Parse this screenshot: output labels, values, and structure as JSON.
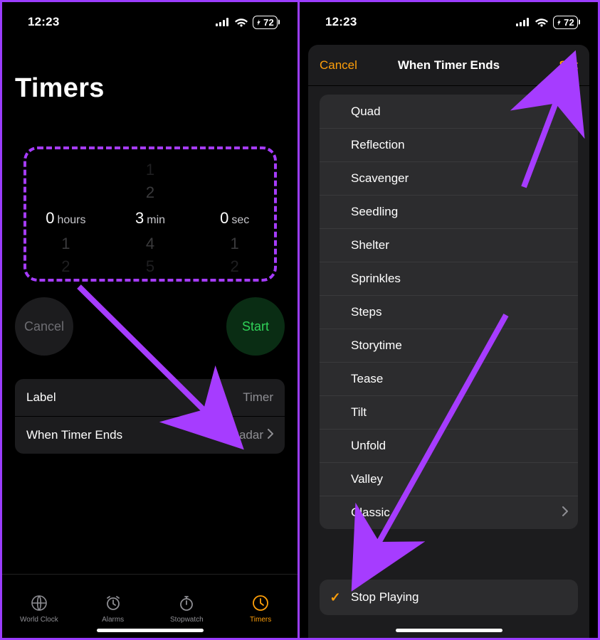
{
  "left": {
    "status": {
      "time": "12:23",
      "battery": "72"
    },
    "title": "Timers",
    "picker": {
      "hours": {
        "cur": "0",
        "m1": "",
        "m2": "",
        "p1": "1",
        "p2": "2",
        "unit": "hours"
      },
      "minutes": {
        "cur": "3",
        "m1": "2",
        "m2": "1",
        "p1": "4",
        "p2": "5",
        "unit": "min"
      },
      "seconds": {
        "cur": "0",
        "m1": "",
        "m2": "",
        "p1": "1",
        "p2": "2",
        "unit": "sec"
      }
    },
    "buttons": {
      "cancel": "Cancel",
      "start": "Start"
    },
    "settings": {
      "label_title": "Label",
      "label_value": "Timer",
      "ends_title": "When Timer Ends",
      "ends_value": "Radar"
    },
    "tabs": {
      "world": "World Clock",
      "alarms": "Alarms",
      "stopwatch": "Stopwatch",
      "timers": "Timers"
    }
  },
  "right": {
    "status": {
      "time": "12:23",
      "battery": "72"
    },
    "modal": {
      "cancel": "Cancel",
      "title": "When Timer Ends",
      "set": "Set",
      "sounds": [
        "Quad",
        "Reflection",
        "Scavenger",
        "Seedling",
        "Shelter",
        "Sprinkles",
        "Steps",
        "Storytime",
        "Tease",
        "Tilt",
        "Unfold",
        "Valley",
        "Classic"
      ],
      "stop": "Stop Playing"
    }
  }
}
